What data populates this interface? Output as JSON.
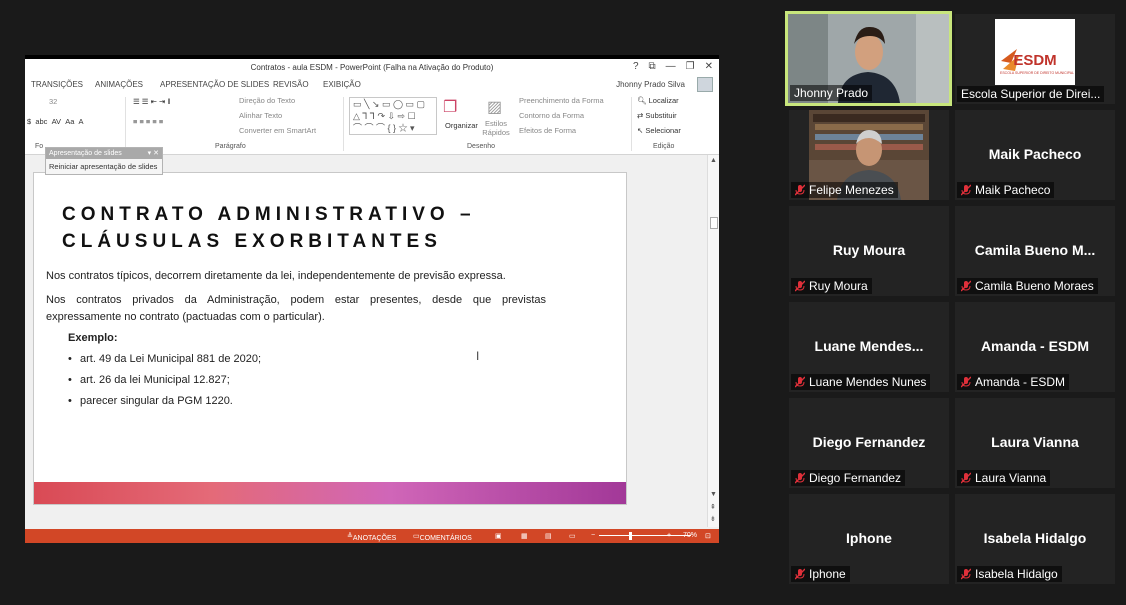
{
  "ppt": {
    "title": "Contratos - aula ESDM - PowerPoint (Falha na Ativação do Produto)",
    "window_buttons": [
      "?",
      "⧉",
      "—",
      "❐",
      "✕"
    ],
    "tabs": [
      "TRANSIÇÕES",
      "ANIMAÇÕES",
      "APRESENTAÇÃO DE SLIDES",
      "REVISÃO",
      "EXIBIÇÃO"
    ],
    "user": "Jhonny Prado Silva",
    "ribbon": {
      "font_size": "32",
      "paragraph_group": "Parágrafo",
      "draw_group": "Desenho",
      "edit_group": "Edição",
      "font_group": "Fo",
      "text_direction": "Direção do Texto",
      "align_text": "Alinhar Texto",
      "convert_smartart": "Converter em SmartArt",
      "arrange": "Organizar",
      "quick_styles": "Estilos Rápidos",
      "shape_fill": "Preenchimento da Forma",
      "shape_outline": "Contorno da Forma",
      "shape_effects": "Efeitos de Forma",
      "find": "Localizar",
      "replace": "Substituir",
      "select": "Selecionar"
    },
    "popup": {
      "header": "Apresentação de slides",
      "item": "Reiniciar apresentação de slides"
    },
    "slide": {
      "heading_line1": "CONTRATO ADMINISTRATIVO –",
      "heading_line2": "CLÁUSULAS EXORBITANTES",
      "para1": "Nos contratos típicos, decorrem diretamente da lei, independentemente de previsão expressa.",
      "para2": "Nos contratos privados da Administração, podem estar presentes, desde que previstas expressamente no contrato (pactuadas com o particular).",
      "example_label": "Exemplo:",
      "bullets": [
        "art. 49 da Lei Municipal 881 de 2020;",
        "art. 26 da lei Municipal 12.827;",
        "parecer singular da PGM 1220."
      ]
    },
    "status": {
      "notes": "ANOTAÇÕES",
      "comments": "COMENTÁRIOS",
      "zoom": "70%",
      "zoom_percent": 70
    }
  },
  "participants": [
    {
      "name": "Jhonny Prado",
      "muted": false,
      "video": true,
      "active": true
    },
    {
      "name": "Escola Superior de Direi...",
      "muted": false,
      "video": true,
      "logo": "ESDM",
      "logo_sub": "ESCOLA SUPERIOR DE DIREITO MUNICIPAL"
    },
    {
      "name": "Felipe Menezes",
      "muted": true,
      "video": true
    },
    {
      "name": "Maik Pacheco",
      "center": "Maik Pacheco",
      "muted": true
    },
    {
      "name": "Ruy Moura",
      "center": "Ruy Moura",
      "muted": true
    },
    {
      "name": "Camila Bueno Moraes",
      "center": "Camila  Bueno  M...",
      "muted": true
    },
    {
      "name": "Luane Mendes Nunes",
      "center": "Luane  Mendes...",
      "muted": true
    },
    {
      "name": "Amanda - ESDM",
      "center": "Amanda - ESDM",
      "muted": true
    },
    {
      "name": "Diego Fernandez",
      "center": "Diego Fernandez",
      "muted": true
    },
    {
      "name": "Laura Vianna",
      "center": "Laura Vianna",
      "muted": true
    },
    {
      "name": "Iphone",
      "center": "Iphone",
      "muted": true
    },
    {
      "name": "Isabela Hidalgo",
      "center": "Isabela Hidalgo",
      "muted": true
    }
  ],
  "colors": {
    "active_border": "#c8e67c",
    "ppt_accent": "#d24726",
    "muted_icon": "#e0303a"
  }
}
